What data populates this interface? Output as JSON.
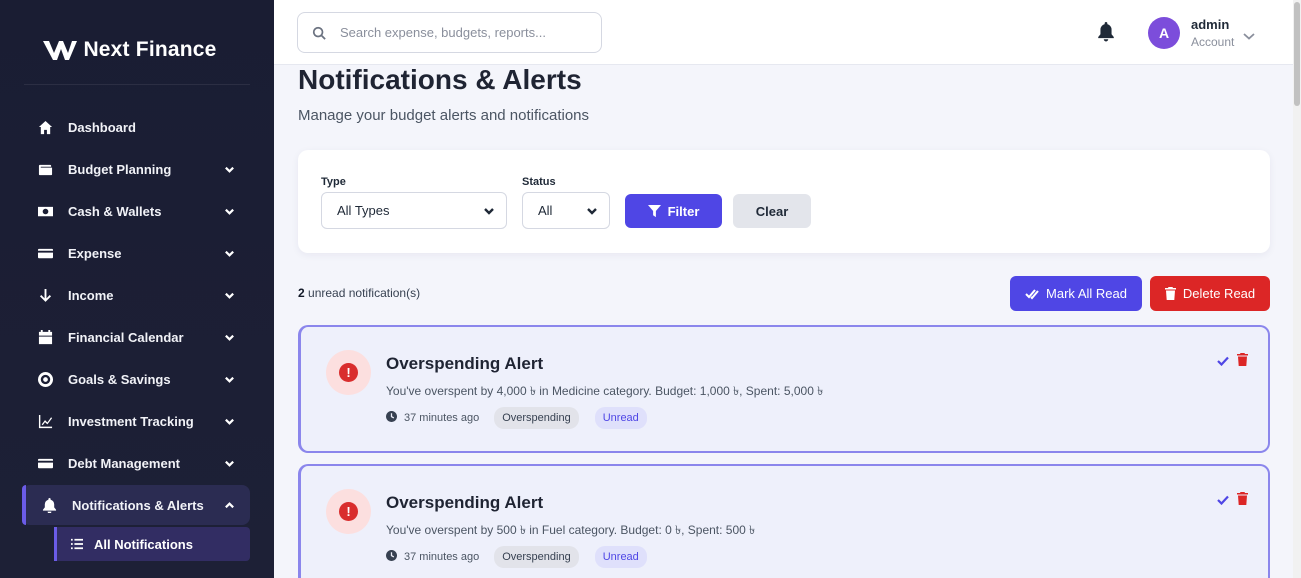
{
  "brand": {
    "name": "Next Finance"
  },
  "sidebar": {
    "items": [
      {
        "label": "Dashboard",
        "icon": "home-icon",
        "has_chevron": false
      },
      {
        "label": "Budget Planning",
        "icon": "wallet-icon",
        "has_chevron": true
      },
      {
        "label": "Cash & Wallets",
        "icon": "money-icon",
        "has_chevron": true
      },
      {
        "label": "Expense",
        "icon": "credit-card-icon",
        "has_chevron": true
      },
      {
        "label": "Income",
        "icon": "arrow-down-icon",
        "has_chevron": true
      },
      {
        "label": "Financial Calendar",
        "icon": "calendar-icon",
        "has_chevron": true
      },
      {
        "label": "Goals & Savings",
        "icon": "target-icon",
        "has_chevron": true
      },
      {
        "label": "Investment Tracking",
        "icon": "chart-line-icon",
        "has_chevron": true
      },
      {
        "label": "Debt Management",
        "icon": "credit-card-icon",
        "has_chevron": true
      },
      {
        "label": "Notifications & Alerts",
        "icon": "bell-icon",
        "has_chevron": true,
        "active": true
      }
    ],
    "subitem": {
      "label": "All Notifications",
      "icon": "list-icon"
    }
  },
  "header": {
    "search_placeholder": "Search expense, budgets, reports...",
    "user": {
      "initial": "A",
      "name": "admin",
      "role": "Account"
    }
  },
  "page": {
    "title": "Notifications & Alerts",
    "subtitle": "Manage your budget alerts and notifications"
  },
  "filters": {
    "type_label": "Type",
    "type_value": "All Types",
    "status_label": "Status",
    "status_value": "All",
    "filter_button": "Filter",
    "clear_button": "Clear"
  },
  "summary": {
    "unread_count": "2",
    "unread_text": " unread notification(s)",
    "mark_all_read": "Mark All Read",
    "delete_read": "Delete Read"
  },
  "notifications": [
    {
      "title": "Overspending Alert",
      "message": "You've overspent by 4,000 ৳ in Medicine category. Budget: 1,000 ৳, Spent: 5,000 ৳",
      "time": "37 minutes ago",
      "category": "Overspending",
      "status": "Unread"
    },
    {
      "title": "Overspending Alert",
      "message": "You've overspent by 500 ৳ in Fuel category. Budget: 0 ৳, Spent: 500 ৳",
      "time": "37 minutes ago",
      "category": "Overspending",
      "status": "Unread"
    }
  ],
  "colors": {
    "sidebar_bg": "#1a1d33",
    "accent": "#4f46e5",
    "danger": "#dc2626",
    "avatar": "#7c4ddb"
  }
}
